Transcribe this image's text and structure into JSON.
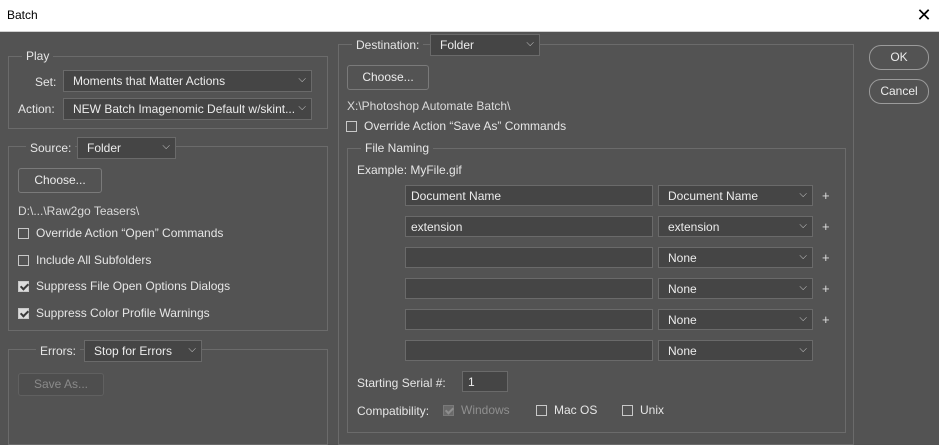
{
  "window": {
    "title": "Batch",
    "close_icon": "close-icon"
  },
  "buttons": {
    "ok": "OK",
    "cancel": "Cancel"
  },
  "play": {
    "legend": "Play",
    "set_label": "Set:",
    "set_value": "Moments that Matter Actions",
    "action_label": "Action:",
    "action_value": "NEW Batch Imagenomic Default w/skint..."
  },
  "source": {
    "label": "Source:",
    "value": "Folder",
    "choose": "Choose...",
    "path": "D:\\...\\Raw2go Teasers\\",
    "override_open": {
      "label": "Override Action “Open” Commands",
      "checked": false
    },
    "include_subfolders": {
      "label": "Include All Subfolders",
      "checked": false
    },
    "suppress_open": {
      "label": "Suppress File Open Options Dialogs",
      "checked": true
    },
    "suppress_color": {
      "label": "Suppress Color Profile Warnings",
      "checked": true
    }
  },
  "errors": {
    "label": "Errors:",
    "value": "Stop for Errors",
    "save_as": "Save As..."
  },
  "destination": {
    "label": "Destination:",
    "value": "Folder",
    "choose": "Choose...",
    "path": "X:\\Photoshop Automate Batch\\",
    "override_save": {
      "label": "Override Action “Save As” Commands",
      "checked": false
    }
  },
  "file_naming": {
    "legend": "File Naming",
    "example": "Example: MyFile.gif",
    "rows": [
      {
        "text": "Document Name",
        "select": "Document Name",
        "plus": "+"
      },
      {
        "text": "extension",
        "select": "extension",
        "plus": "+"
      },
      {
        "text": "",
        "select": "None",
        "plus": "+"
      },
      {
        "text": "",
        "select": "None",
        "plus": "+"
      },
      {
        "text": "",
        "select": "None",
        "plus": "+"
      },
      {
        "text": "",
        "select": "None",
        "plus": ""
      }
    ],
    "serial_label": "Starting Serial #:",
    "serial_value": "1",
    "compat_label": "Compatibility:",
    "windows": {
      "label": "Windows",
      "checked": true,
      "disabled": true
    },
    "macos": {
      "label": "Mac OS",
      "checked": false
    },
    "unix": {
      "label": "Unix",
      "checked": false
    }
  }
}
